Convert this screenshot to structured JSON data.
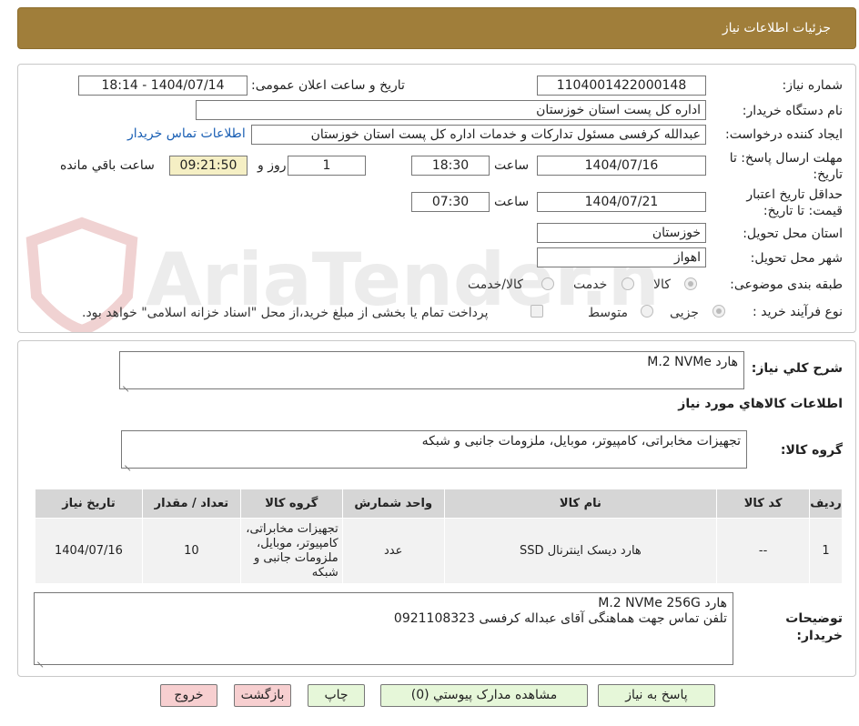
{
  "header": {
    "title": "جزئیات اطلاعات نیاز"
  },
  "form": {
    "need_number": {
      "label": "شماره نیاز:",
      "value": "1104001422000148"
    },
    "announce_datetime": {
      "label": "تاریخ و ساعت اعلان عمومی:",
      "value": "1404/07/14 - 18:14"
    },
    "buyer_org": {
      "label": "نام دستگاه خریدار:",
      "value": "اداره کل پست استان خوزستان"
    },
    "requester": {
      "label": "ایجاد کننده درخواست:",
      "value": "عبدالله کرفسی مسئول تدارکات و خدمات اداره کل پست استان خوزستان",
      "contact_link": "اطلاعات تماس خریدار"
    },
    "reply_deadline": {
      "label_line1": "مهلت ارسال پاسخ: تا",
      "label_line2": "تاریخ:",
      "date": "1404/07/16",
      "time_label": "ساعت",
      "time": "18:30",
      "days": "1",
      "days_label": "روز و",
      "remaining": "09:21:50",
      "remaining_label": "ساعت باقي مانده"
    },
    "price_validity": {
      "label_line1": "حداقل تاریخ اعتبار",
      "label_line2": "قیمت: تا تاریخ:",
      "date": "1404/07/21",
      "time_label": "ساعت",
      "time": "07:30"
    },
    "delivery_province": {
      "label": "استان محل تحویل:",
      "value": "خوزستان"
    },
    "delivery_city": {
      "label": "شهر محل تحویل:",
      "value": "اهواز"
    },
    "subject_class": {
      "label": "طبقه بندی موضوعی:",
      "options": [
        "کالا",
        "خدمت",
        "کالا/خدمت"
      ],
      "selected": "کالا"
    },
    "purchase_process": {
      "label": "نوع فرآیند خرید :",
      "options": [
        "جزیی",
        "متوسط"
      ],
      "selected": "جزیی",
      "payment_note": "پرداخت تمام یا بخشی از مبلغ خرید،از محل \"اسناد خزانه اسلامی\" خواهد بود."
    }
  },
  "summary": {
    "description_label": "شرح کلي نیاز:",
    "description_value": "هارد M.2 NVMe",
    "goods_info_title": "اطلاعات کالاهاي مورد نياز",
    "goods_group_label": "گروه کالا:",
    "goods_group_value": "تجهیزات مخابراتی، کامپیوتر، موبایل، ملزومات جانبی و شبکه"
  },
  "table": {
    "headers": [
      "ردیف",
      "کد کالا",
      "نام کالا",
      "واحد شمارش",
      "گروه کالا",
      "تعداد / مقدار",
      "تاریخ نیاز"
    ],
    "rows": [
      {
        "row": "1",
        "code": "--",
        "name": "هارد دیسک اینترنال SSD",
        "unit": "عدد",
        "group": "تجهیزات مخابراتی، کامپیوتر، موبایل، ملزومات جانبی و شبکه",
        "qty": "10",
        "date": "1404/07/16"
      }
    ]
  },
  "buyer_notes": {
    "label_line1": "توضیحات",
    "label_line2": "خریدار:",
    "line1": "هارد M.2 NVMe 256G",
    "line2": "تلفن تماس جهت هماهنگی آقای عبداله کرفسی 0921108323"
  },
  "actions": {
    "reply": "پاسخ به نیاز",
    "attachments": "مشاهده مدارک پیوستي (0)",
    "print": "چاپ",
    "back": "بازگشت",
    "exit": "خروج"
  },
  "watermark": "AriaTender.neT",
  "colors": {
    "header_bg": "#a07e3a",
    "link": "#1a5fb4",
    "remaining_bg": "#f5efc4",
    "btn_green": "#e6f7d9",
    "btn_pink": "#f7cfd0",
    "table_header": "#d6d6d6"
  }
}
